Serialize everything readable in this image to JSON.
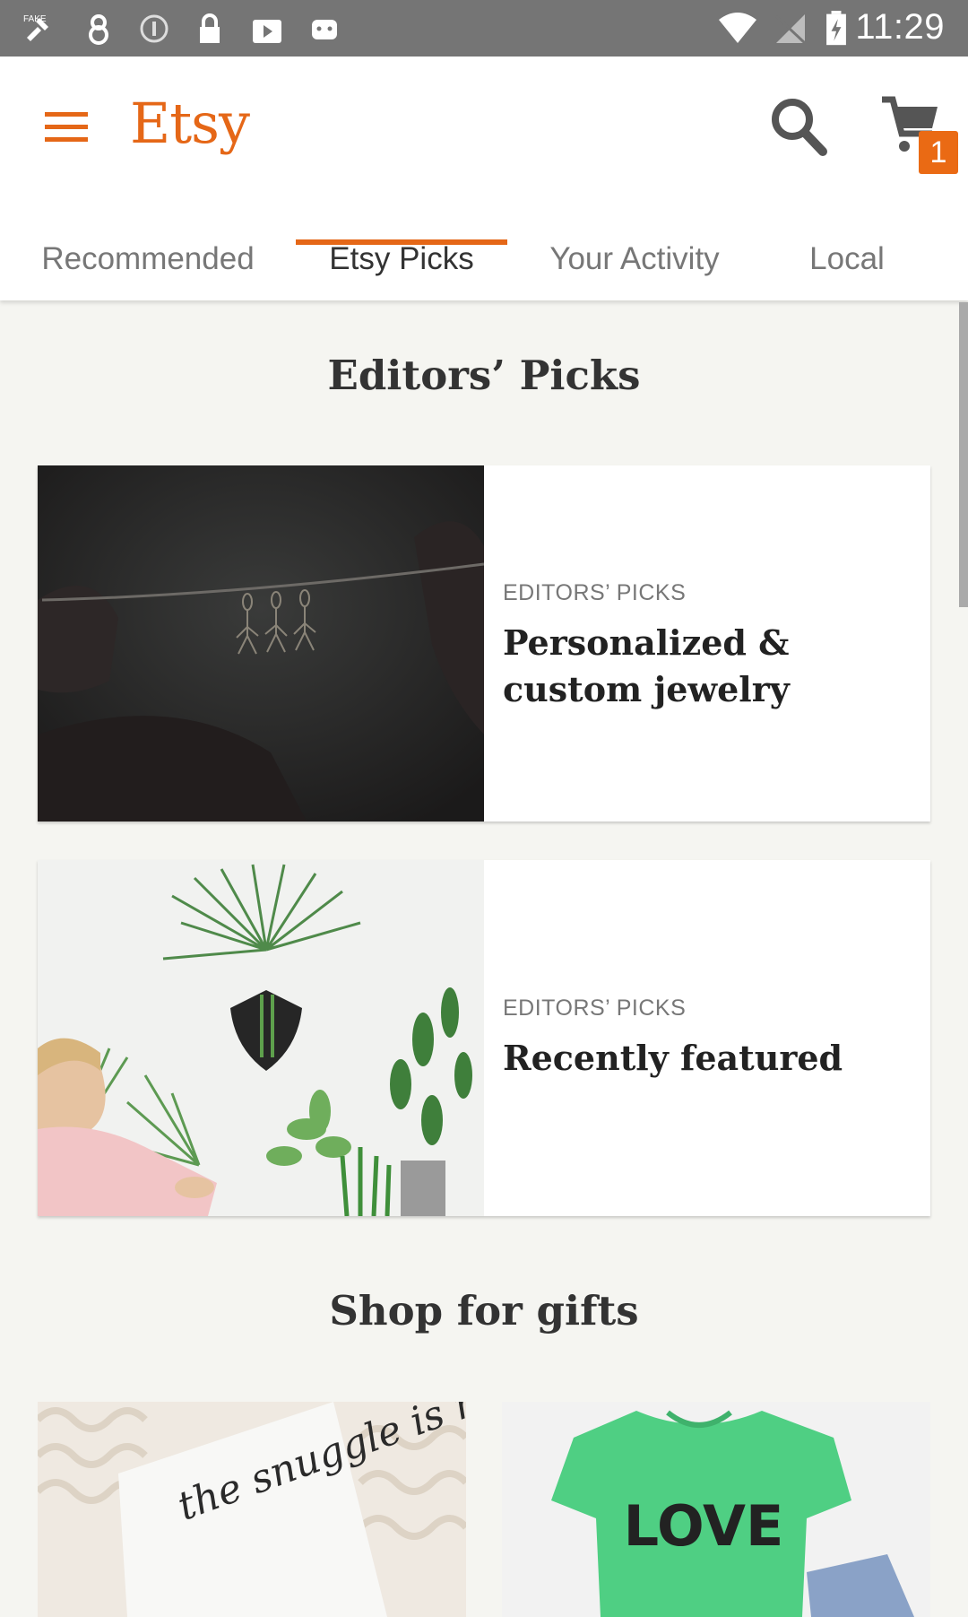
{
  "status_bar": {
    "time": "11:29"
  },
  "header": {
    "logo": "Etsy",
    "cart_count": "1",
    "accent_color": "#e56717"
  },
  "tabs": [
    {
      "label": "Recommended",
      "active": false
    },
    {
      "label": "Etsy Picks",
      "active": true
    },
    {
      "label": "Your Activity",
      "active": false
    },
    {
      "label": "Local",
      "active": false
    }
  ],
  "editors_picks": {
    "title": "Editors’ Picks",
    "cards": [
      {
        "eyebrow": "EDITORS’ PICKS",
        "title": "Personalized & custom jewelry"
      },
      {
        "eyebrow": "EDITORS’ PICKS",
        "title": "Recently featured"
      }
    ]
  },
  "gifts": {
    "title": "Shop for gifts",
    "tiles": [
      {
        "image_text": "the snuggle is real"
      },
      {
        "image_text": "LOVE"
      }
    ]
  }
}
